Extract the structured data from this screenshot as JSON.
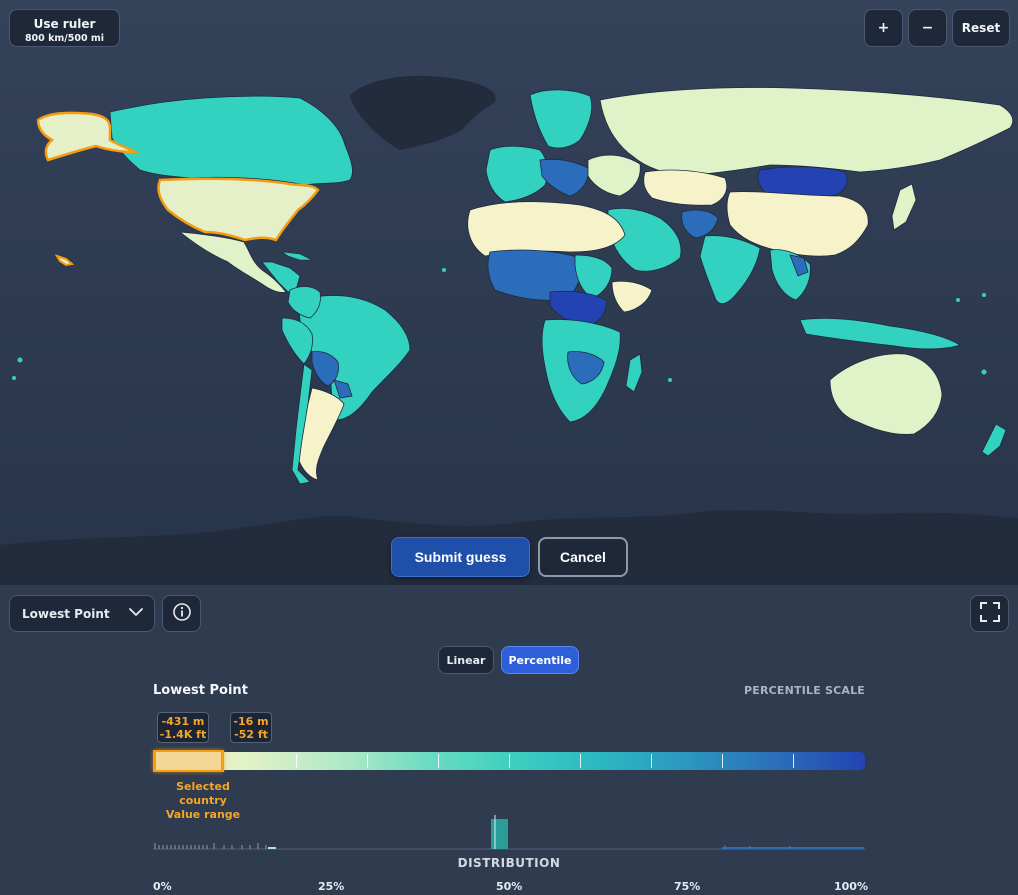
{
  "map": {
    "ruler_button": {
      "label": "Use ruler",
      "scale": "800 km/500 mi"
    },
    "zoom_in_label": "+",
    "zoom_out_label": "−",
    "reset_label": "Reset",
    "submit_label": "Submit guess",
    "cancel_label": "Cancel",
    "selected_country": "United States",
    "colors": {
      "ocean": "#2f3d55",
      "selected_outline": "#f59c10",
      "land_low": "#f6f2c9",
      "land_mid": "#3fd0c0",
      "land_high": "#2343b2"
    }
  },
  "panel": {
    "metric_select": {
      "selected": "Lowest Point",
      "icon": "chevron-down-icon"
    },
    "info_icon": "info-icon",
    "fullscreen_icon": "fullscreen-icon",
    "scale_toggle": {
      "linear_label": "Linear",
      "percentile_label": "Percentile",
      "active": "Percentile"
    },
    "legend_title": "Lowest Point",
    "scale_label": "PERCENTILE SCALE",
    "selected_range": {
      "min_m": "-431 m",
      "min_ft": "-1.4K ft",
      "max_m": "-16 m",
      "max_ft": "-52 ft",
      "start_pct": 0,
      "end_pct": 10
    },
    "selected_caption_1": "Selected country",
    "selected_caption_2": "Value range",
    "distribution_label": "DISTRIBUTION",
    "axis_ticks": [
      "0%",
      "25%",
      "50%",
      "75%",
      "100%"
    ]
  }
}
